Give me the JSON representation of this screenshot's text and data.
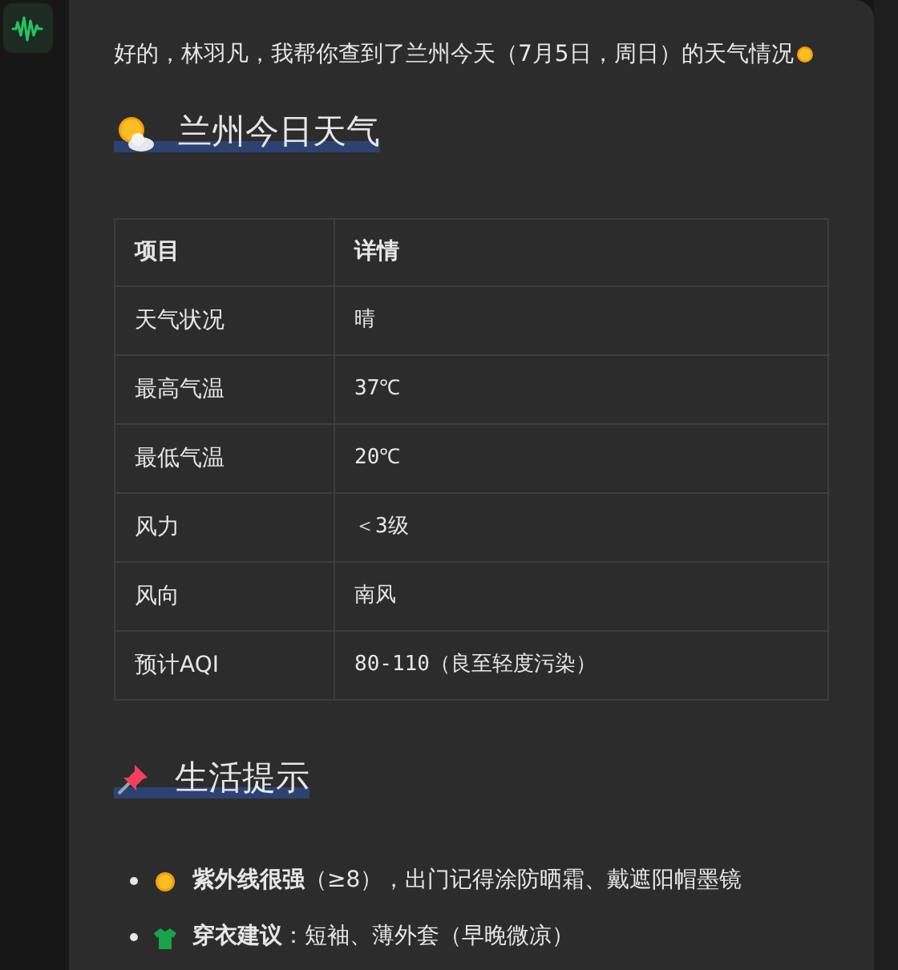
{
  "intro": "好的，林羽凡，我帮你查到了兰州今天（7月5日，周日）的天气情况",
  "weather_heading": "兰州今日天气",
  "table": {
    "columns": [
      "项目",
      "详情"
    ],
    "rows": [
      [
        "天气状况",
        "晴"
      ],
      [
        "最高气温",
        "37℃"
      ],
      [
        "最低气温",
        "20℃"
      ],
      [
        "风力",
        "＜3级"
      ],
      [
        "风向",
        "南风"
      ],
      [
        "预计AQI",
        "80-110（良至轻度污染）"
      ]
    ]
  },
  "tips_heading": "生活提示",
  "tips": [
    {
      "kind": "sun",
      "text": "**紫外线很强**（≥8），出门记得涂防晒霜、戴遮阳帽墨镜"
    },
    {
      "kind": "shirt",
      "text": "**穿衣建议**：短袖、薄外套（早晚微凉）"
    }
  ]
}
